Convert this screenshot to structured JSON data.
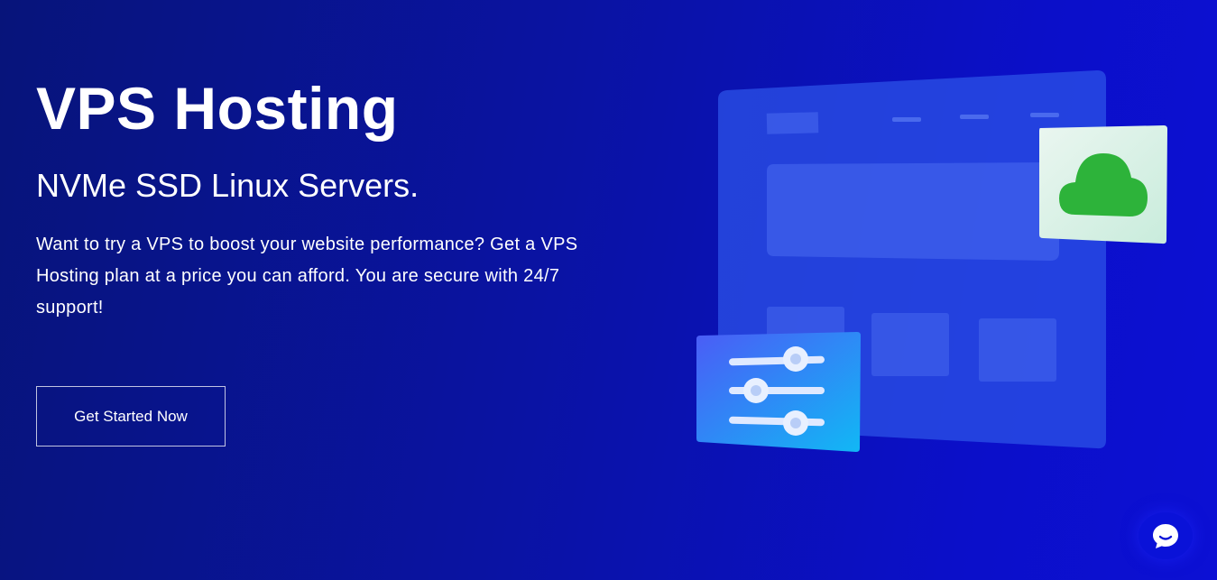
{
  "hero": {
    "title": "VPS Hosting",
    "subtitle": "NVMe SSD Linux Servers.",
    "description": "Want to try a VPS to boost your website performance? Get a VPS Hosting plan at a price you can afford. You are secure with 24/7 support!",
    "cta_label": "Get Started Now"
  },
  "illustration": {
    "icons": [
      "cloud-icon",
      "sliders-icon"
    ]
  },
  "chat": {
    "icon": "chat-bubble-icon"
  },
  "colors": {
    "background": "#0a13a3",
    "panel": "#2a4fe6",
    "cloud": "#2db33a",
    "cloud_card": "#d8f0e8",
    "slider_card": "#1e90ff"
  }
}
